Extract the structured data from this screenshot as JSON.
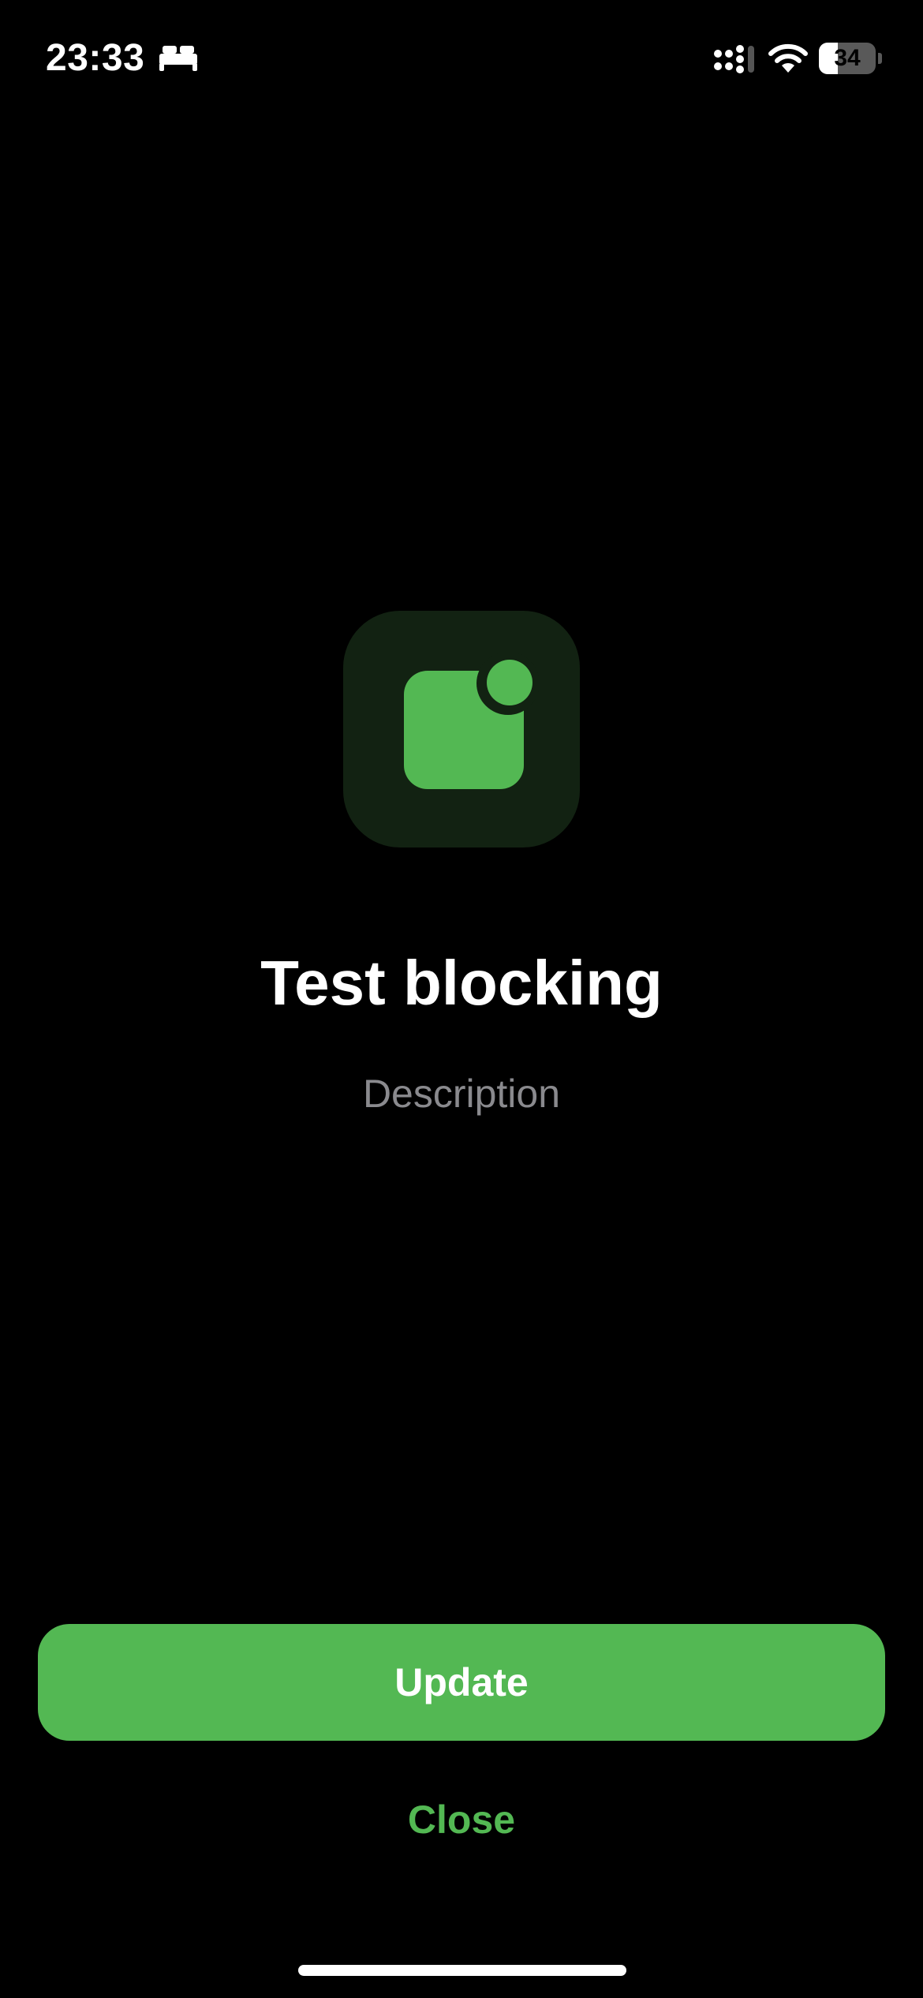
{
  "status_bar": {
    "time": "23:33",
    "focus_icon": "bed-icon",
    "signal_icon": "cellular-signal-icon",
    "wifi_icon": "wifi-icon",
    "battery_percent": "34",
    "battery_level": 0.34
  },
  "main": {
    "app_icon": "notification-badge-icon",
    "title": "Test blocking",
    "description": "Description"
  },
  "actions": {
    "update_label": "Update",
    "close_label": "Close"
  },
  "colors": {
    "background": "#000000",
    "accent": "#53b853",
    "icon_background": "#122212",
    "secondary_text": "#8a8a8e"
  }
}
